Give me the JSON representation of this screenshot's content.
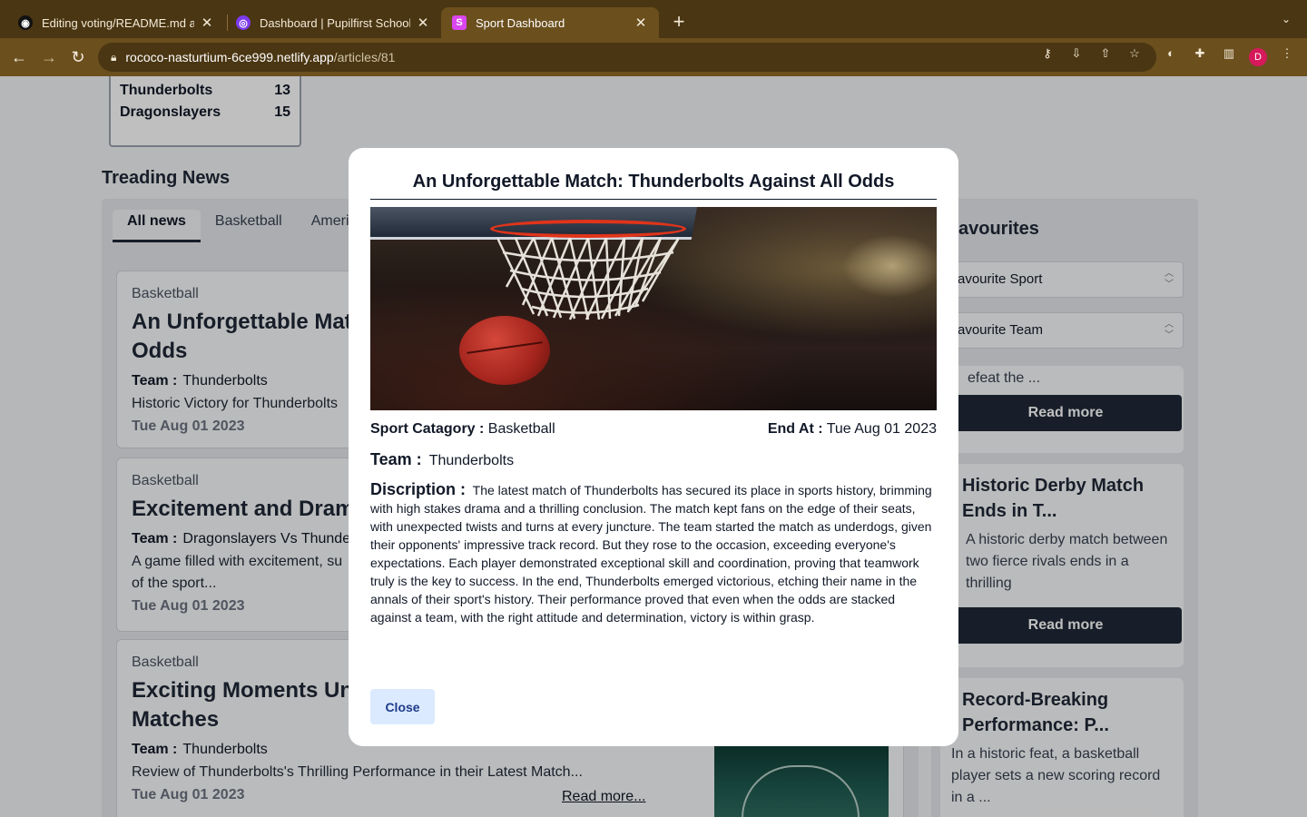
{
  "browser": {
    "tabs": [
      {
        "title": "Editing voting/README.md at m",
        "active": false
      },
      {
        "title": "Dashboard | Pupilfirst School | ",
        "active": false
      },
      {
        "title": "Sport Dashboard",
        "active": true
      }
    ],
    "new_tab": "+",
    "url_host": "rococo-nasturtium-6ce999.netlify.app",
    "url_path": "/articles/81",
    "profile_initial": "D"
  },
  "page": {
    "scores": [
      {
        "team": "Thunderbolts",
        "score": "13"
      },
      {
        "team": "Dragonslayers",
        "score": "15"
      }
    ],
    "section_title": "Treading News",
    "news_tabs": [
      "All news",
      "Basketball",
      "Ameri"
    ],
    "news_cards": [
      {
        "category": "Basketball",
        "title": "An Unforgettable Mat… Odds",
        "title_line1": "An Unforgettable Mat",
        "title_line2": "Odds",
        "team_label": "Team :",
        "team": "Thunderbolts",
        "desc": "Historic Victory for Thunderbolts",
        "date": "Tue Aug 01 2023"
      },
      {
        "category": "Basketball",
        "title_line1": "Excitement and Dram",
        "team_label": "Team :",
        "team": "Dragonslayers Vs Thunde",
        "desc_line1": "A game filled with excitement, su",
        "desc_line2": "of the sport...",
        "date": "Tue Aug 01 2023"
      },
      {
        "category": "Basketball",
        "title_line1": "Exciting Moments Unt",
        "title_line2": "Matches",
        "team_label": "Team :",
        "team": "Thunderbolts",
        "desc": "Review of Thunderbolts's Thrilling Performance in their Latest Match...",
        "date": "Tue Aug 01 2023",
        "read_more": "Read more..."
      }
    ],
    "favourites": {
      "title": "avourites",
      "sport_placeholder": "avourite Sport",
      "team_placeholder": "avourite Team",
      "cards": [
        {
          "desc": "efeat the ...",
          "button": "Read more"
        },
        {
          "title_line1": "Historic Derby Match",
          "title_line2": "Ends in T...",
          "desc_line1": "A historic derby match between",
          "desc_line2": "two fierce rivals ends in a thrilling",
          "desc_line3": "...",
          "button": "Read more"
        },
        {
          "title_line1": "Record-Breaking",
          "title_line2": "Performance: P...",
          "desc_line1": "In a historic feat, a basketball",
          "desc_line2": "player sets a new scoring record",
          "desc_line3": "in a ..."
        }
      ]
    }
  },
  "modal": {
    "title": "An Unforgettable Match: Thunderbolts Against All Odds",
    "sport_label": "Sport Catagory :",
    "sport_value": "Basketball",
    "end_label": "End At :",
    "end_value": "Tue Aug 01 2023",
    "team_label": "Team :",
    "team_value": "Thunderbolts",
    "description_label": "Discription :",
    "description": "The latest match of Thunderbolts has secured its place in sports history, brimming with high stakes drama and a thrilling conclusion. The match kept fans on the edge of their seats, with unexpected twists and turns at every juncture. The team started the match as underdogs, given their opponents' impressive track record. But they rose to the occasion, exceeding everyone's expectations. Each player demonstrated exceptional skill and coordination, proving that teamwork truly is the key to success. In the end, Thunderbolts emerged victorious, etching their name in the annals of their sport's history. Their performance proved that even when the odds are stacked against a team, with the right attitude and determination, victory is within grasp.",
    "close_label": "Close"
  },
  "colors": {
    "tabbar": "#4a3612",
    "toolbar": "#6b4f1d",
    "dark_button": "#1f2937",
    "close_button": "#dbeafe"
  }
}
